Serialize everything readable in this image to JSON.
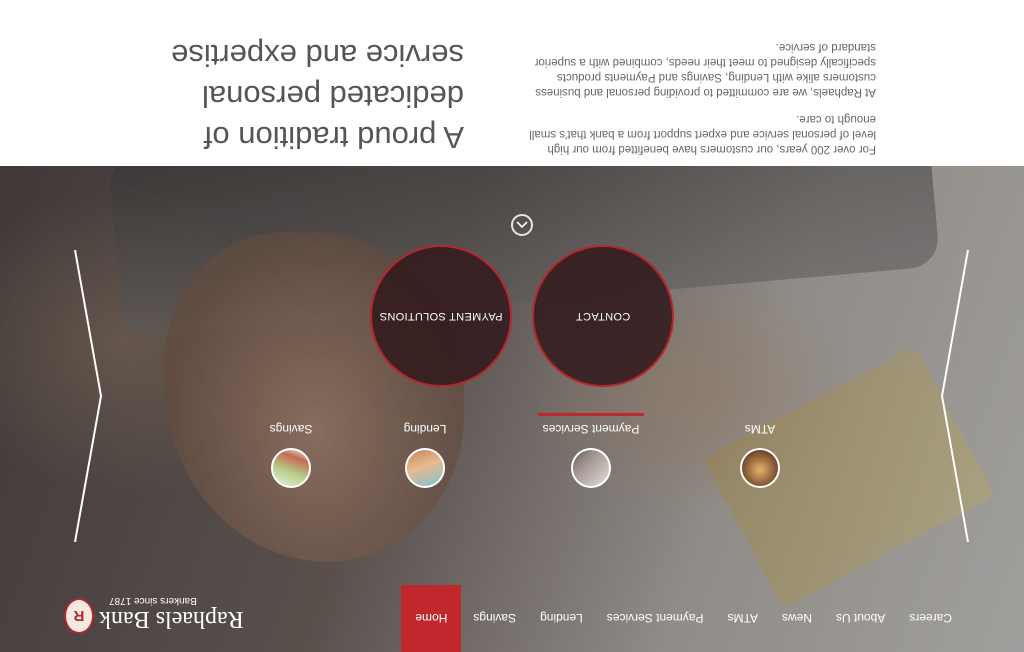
{
  "brand": {
    "name": "Raphaels Bank",
    "tagline": "Bankers since 1787",
    "badge_letter": "R"
  },
  "nav": {
    "items": [
      "Home",
      "Savings",
      "Lending",
      "Payment Services",
      "ATMs",
      "News",
      "About Us",
      "Careers"
    ],
    "active_index": 0
  },
  "hero": {
    "circles": {
      "payment": "PAYMENT SOLUTIONS",
      "contact": "CONTACT"
    },
    "products": [
      "Savings",
      "Lending",
      "Payment Services",
      "ATMs"
    ],
    "selected_product_index": 2,
    "icons": {
      "prev": "chevron-left-icon",
      "next": "chevron-right-icon",
      "up": "chevron-up-icon"
    }
  },
  "info": {
    "headline": "A proud tradition of dedicated personal service and expertise",
    "paragraphs": [
      "For over 200 years, our customers have benefitted from our high level of personal service and expert support from a bank that's small enough to care.",
      "At Raphaels, we are committed to providing personal and business customers alike with Lending, Savings and Payments products specifically designed to meet their needs, combined with a superior standard of service."
    ]
  },
  "colors": {
    "accent": "#c0282e",
    "text": "#555555",
    "white": "#ffffff"
  }
}
